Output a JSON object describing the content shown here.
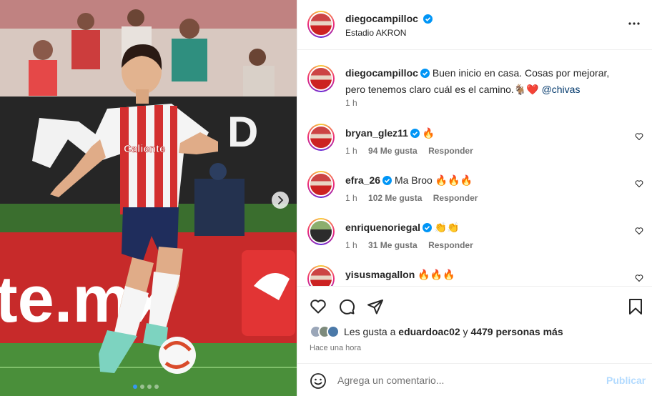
{
  "post": {
    "author": "diegocampilloc",
    "location": "Estadio AKRON"
  },
  "photo": {
    "alt_brand_text": "te.mx",
    "jersey_text": "Caliente caliente.mx",
    "slide_count": 4,
    "active_slide": 1
  },
  "caption": {
    "author": "diegocampilloc",
    "text": "Buen inicio en casa. Cosas por mejorar, pero tenemos claro cuál es el camino.",
    "emoji": "🐐❤️",
    "mention": "@chivas",
    "time": "1 h"
  },
  "comments": [
    {
      "user": "bryan_glez11",
      "text": "🔥",
      "time": "1 h",
      "likes": "94 Me gusta",
      "reply": "Responder"
    },
    {
      "user": "efra_26",
      "text": "Ma Broo 🔥🔥🔥",
      "time": "1 h",
      "likes": "102 Me gusta",
      "reply": "Responder"
    },
    {
      "user": "enriquenoriegal",
      "text": "👏👏",
      "time": "1 h",
      "likes": "31 Me gusta",
      "reply": "Responder"
    },
    {
      "user": "yisusmagallon",
      "text": "🔥🔥🔥",
      "time": "",
      "likes": "",
      "reply": ""
    }
  ],
  "likes_summary": {
    "prefix": "Les gusta a",
    "user": "eduardoac02",
    "middle": "y",
    "count": "4479 personas más"
  },
  "posted_time": "Hace una hora",
  "composer": {
    "placeholder": "Agrega un comentario...",
    "publish": "Publicar"
  },
  "colors": {
    "link": "#00376b",
    "verified": "#0095f6",
    "publish_disabled": "#b3dbff",
    "active_dot": "#3797f0"
  }
}
